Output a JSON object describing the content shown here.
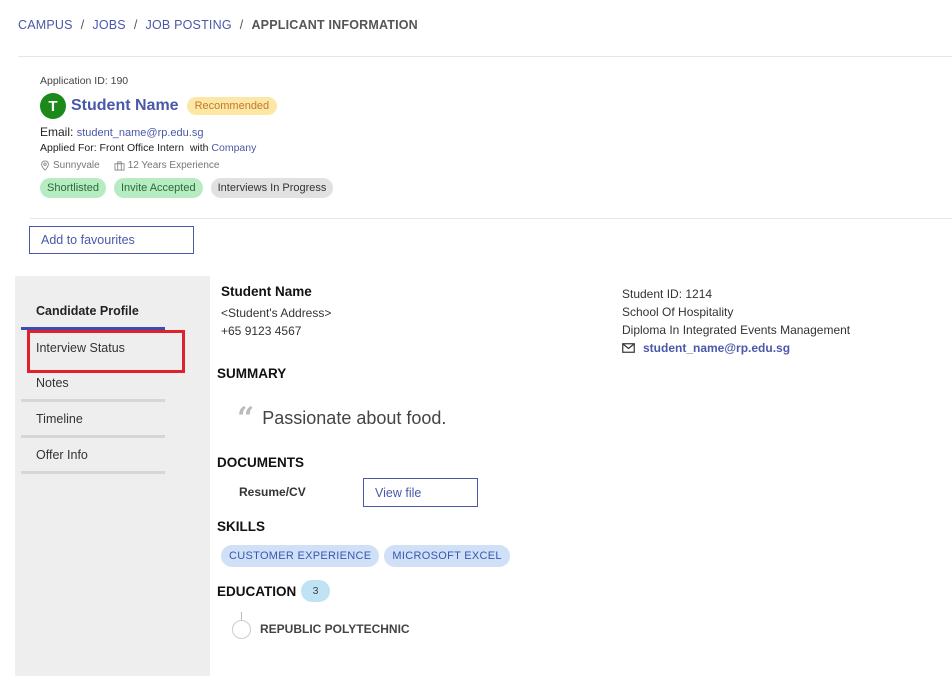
{
  "breadcrumb": {
    "items": [
      "CAMPUS",
      "JOBS",
      "JOB POSTING"
    ],
    "separator": "/",
    "current": "APPLICANT INFORMATION"
  },
  "applicant": {
    "application_id_text": "Application ID: 190",
    "avatar_initial": "T",
    "name": "Student Name",
    "badge": "Recommended",
    "email_label": "Email:",
    "email": "student_name@rp.edu.sg",
    "applied_for_text": "Applied For: Front Office Intern",
    "with_text": "with",
    "company": "Company",
    "location": "Sunnyvale",
    "experience": "12 Years Experience",
    "statuses": [
      "Shortlisted",
      "Invite Accepted",
      "Interviews In Progress"
    ]
  },
  "actions": {
    "add_favourites": "Add to favourites"
  },
  "sidebar": {
    "items": [
      "Candidate Profile",
      "Interview Status",
      "Notes",
      "Timeline",
      "Offer Info"
    ],
    "active_index": 0,
    "highlighted_index": 1
  },
  "profile": {
    "name": "Student Name",
    "address": "<Student's Address>",
    "phone": "+65 9123 4567",
    "student_id": "Student ID: 1214",
    "school": "School Of Hospitality",
    "diploma": "Diploma In Integrated Events Management",
    "email": "student_name@rp.edu.sg"
  },
  "sections": {
    "summary_title": "SUMMARY",
    "summary_text": "Passionate about food.",
    "documents_title": "DOCUMENTS",
    "resume_label": "Resume/CV",
    "view_file": "View file",
    "skills_title": "SKILLS",
    "skills": [
      "CUSTOMER EXPERIENCE",
      "MICROSOFT EXCEL"
    ],
    "education_title": "EDUCATION",
    "education_count": "3",
    "education_institution": "REPUBLIC POLYTECHNIC"
  },
  "colors": {
    "accent": "#4a58a8",
    "avatar": "#1b8a1b",
    "highlight": "#e0202a",
    "active_underline": "#3b4bb0"
  },
  "icons": {
    "location": "location-pin-icon",
    "experience": "briefcase-icon",
    "email": "envelope-icon",
    "quote": "quote-icon"
  }
}
